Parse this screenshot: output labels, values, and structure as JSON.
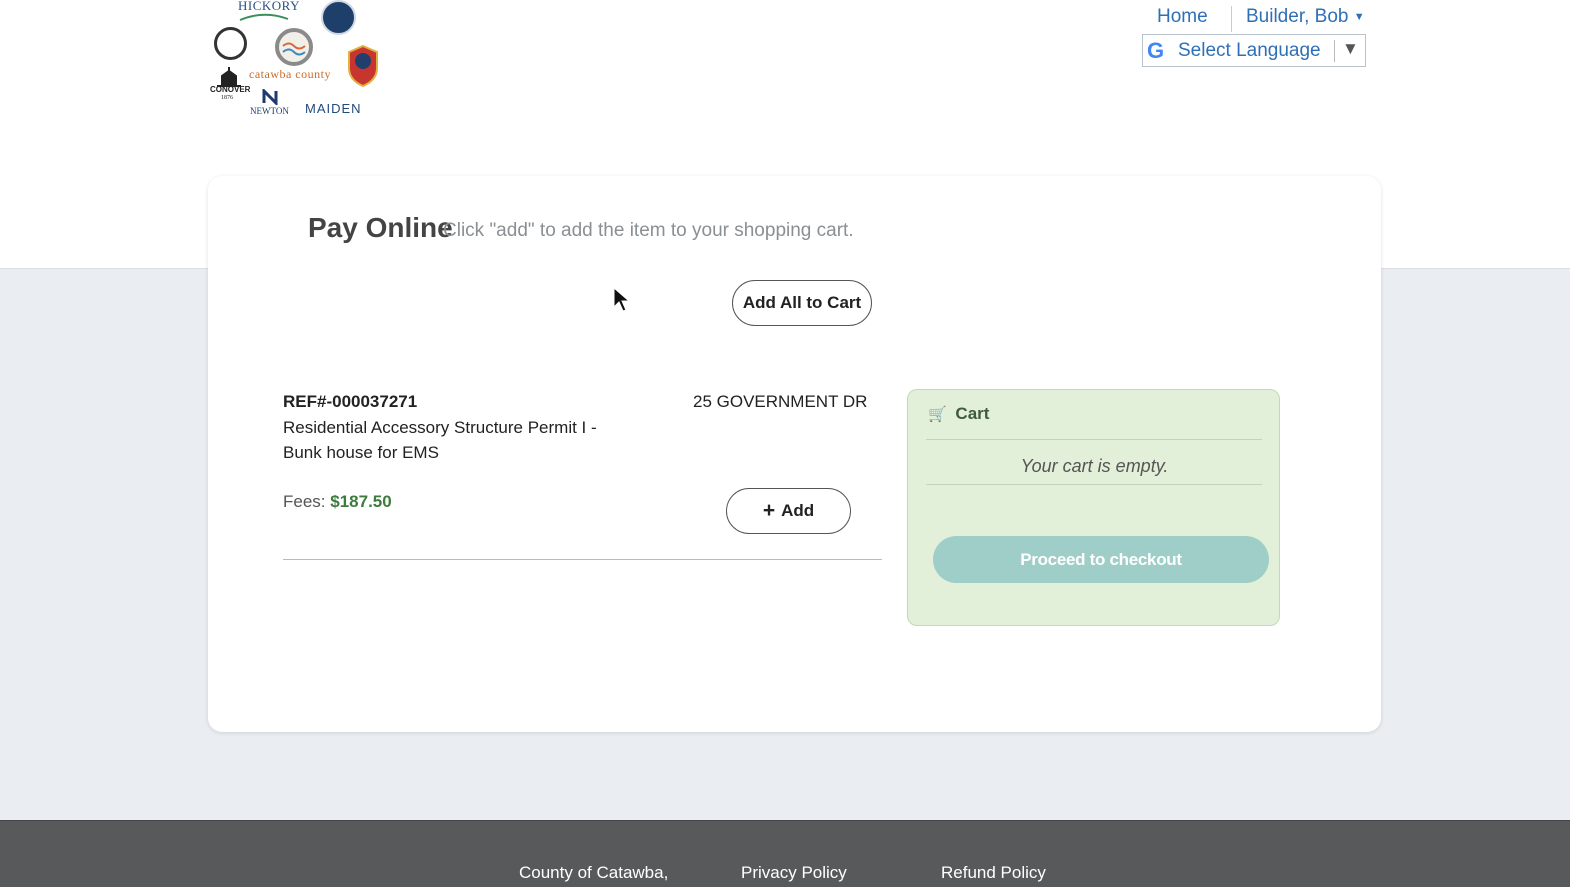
{
  "header": {
    "logos": {
      "hickory": "HICKORY",
      "catawba": "catawba county",
      "conover": "CONOVER",
      "conover_year": "1876",
      "newton": "NEWTON",
      "maiden": "MAIDEN"
    },
    "nav": {
      "home": "Home",
      "user": "Builder, Bob"
    },
    "language": {
      "label": "Select Language",
      "arrow": "▼"
    }
  },
  "page": {
    "title": "Pay Online",
    "subtitle": "Click \"add\" to add the item to your shopping cart.",
    "add_all_label": "Add All to Cart"
  },
  "item": {
    "ref": "REF#-000037271",
    "description": "Residential Accessory Structure Permit I - Bunk house for EMS",
    "address": "25 GOVERNMENT DR",
    "fees_label": "Fees:",
    "fees_amount": "$187.50",
    "add_label": "Add"
  },
  "cart": {
    "title": "Cart",
    "empty_text": "Your cart is empty.",
    "checkout_label": "Proceed to checkout"
  },
  "footer": {
    "links": [
      "County of Catawba,",
      "Privacy Policy",
      "Refund Policy"
    ]
  },
  "colors": {
    "link": "#2f6fb6",
    "fee_amount": "#3e7b3e",
    "cart_bg": "#e2efd9",
    "checkout_bg": "#9fcdc8",
    "footer_bg": "#58595b",
    "page_bg": "#eaedf2"
  }
}
